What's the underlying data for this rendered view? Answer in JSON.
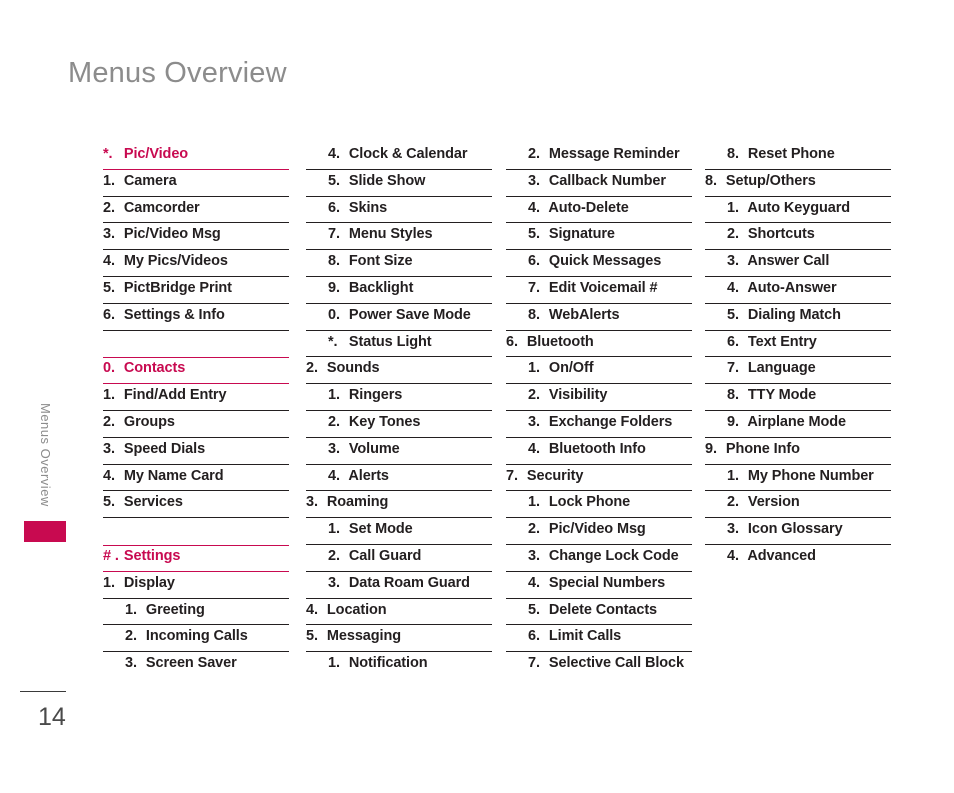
{
  "page": {
    "title": "Menus Overview",
    "side_text": "Menus Overview",
    "page_number": "14",
    "accent_color": "#c80a50",
    "title_color": "#8c8c8c",
    "text_color": "#231f20"
  },
  "columns": [
    {
      "rows": [
        {
          "num": "*.",
          "label": "Pic/Video",
          "level": 1,
          "type": "section",
          "top_rule": false
        },
        {
          "num": "1.",
          "label": "Camera",
          "level": 1,
          "type": "item"
        },
        {
          "num": "2.",
          "label": "Camcorder",
          "level": 1,
          "type": "item"
        },
        {
          "num": "3.",
          "label": "Pic/Video Msg",
          "level": 1,
          "type": "item"
        },
        {
          "num": "4.",
          "label": "My Pics/Videos",
          "level": 1,
          "type": "item"
        },
        {
          "num": "5.",
          "label": "PictBridge Print",
          "level": 1,
          "type": "item"
        },
        {
          "num": "6.",
          "label": "Settings & Info",
          "level": 1,
          "type": "item"
        },
        {
          "type": "spacer"
        },
        {
          "num": "0.",
          "label": "Contacts",
          "level": 1,
          "type": "section",
          "top_rule": true
        },
        {
          "num": "1.",
          "label": "Find/Add Entry",
          "level": 1,
          "type": "item"
        },
        {
          "num": "2.",
          "label": "Groups",
          "level": 1,
          "type": "item"
        },
        {
          "num": "3.",
          "label": "Speed Dials",
          "level": 1,
          "type": "item"
        },
        {
          "num": "4.",
          "label": "My Name Card",
          "level": 1,
          "type": "item"
        },
        {
          "num": "5.",
          "label": "Services",
          "level": 1,
          "type": "item"
        },
        {
          "type": "spacer"
        },
        {
          "num": "# .",
          "label": "Settings",
          "level": 1,
          "type": "section",
          "top_rule": true
        },
        {
          "num": "1.",
          "label": "Display",
          "level": 1,
          "type": "item"
        },
        {
          "num": "1.",
          "label": "Greeting",
          "level": 2,
          "type": "item"
        },
        {
          "num": "2.",
          "label": "Incoming Calls",
          "level": 2,
          "type": "item"
        },
        {
          "num": "3.",
          "label": "Screen Saver",
          "level": 2,
          "type": "item",
          "rule": false
        }
      ]
    },
    {
      "rows": [
        {
          "num": "4.",
          "label": "Clock & Calendar",
          "level": 2,
          "type": "item"
        },
        {
          "num": "5.",
          "label": "Slide Show",
          "level": 2,
          "type": "item"
        },
        {
          "num": "6.",
          "label": "Skins",
          "level": 2,
          "type": "item"
        },
        {
          "num": "7.",
          "label": "Menu Styles",
          "level": 2,
          "type": "item"
        },
        {
          "num": "8.",
          "label": "Font Size",
          "level": 2,
          "type": "item"
        },
        {
          "num": "9.",
          "label": "Backlight",
          "level": 2,
          "type": "item"
        },
        {
          "num": "0.",
          "label": "Power Save Mode",
          "level": 2,
          "type": "item"
        },
        {
          "num": "*.",
          "label": "Status Light",
          "level": 2,
          "type": "item"
        },
        {
          "num": "2.",
          "label": "Sounds",
          "level": 1,
          "type": "item"
        },
        {
          "num": "1.",
          "label": "Ringers",
          "level": 2,
          "type": "item"
        },
        {
          "num": "2.",
          "label": "Key Tones",
          "level": 2,
          "type": "item"
        },
        {
          "num": "3.",
          "label": "Volume",
          "level": 2,
          "type": "item"
        },
        {
          "num": "4.",
          "label": "Alerts",
          "level": 2,
          "type": "item"
        },
        {
          "num": "3.",
          "label": "Roaming",
          "level": 1,
          "type": "item"
        },
        {
          "num": "1.",
          "label": "Set Mode",
          "level": 2,
          "type": "item"
        },
        {
          "num": "2.",
          "label": "Call Guard",
          "level": 2,
          "type": "item"
        },
        {
          "num": "3.",
          "label": "Data Roam Guard",
          "level": 2,
          "type": "item"
        },
        {
          "num": "4.",
          "label": "Location",
          "level": 1,
          "type": "item"
        },
        {
          "num": "5.",
          "label": "Messaging",
          "level": 1,
          "type": "item"
        },
        {
          "num": "1.",
          "label": "Notification",
          "level": 2,
          "type": "item",
          "rule": false
        }
      ]
    },
    {
      "rows": [
        {
          "num": "2.",
          "label": "Message Reminder",
          "level": 2,
          "type": "item"
        },
        {
          "num": "3.",
          "label": "Callback Number",
          "level": 2,
          "type": "item"
        },
        {
          "num": "4.",
          "label": "Auto-Delete",
          "level": 2,
          "type": "item"
        },
        {
          "num": "5.",
          "label": "Signature",
          "level": 2,
          "type": "item"
        },
        {
          "num": "6.",
          "label": "Quick Messages",
          "level": 2,
          "type": "item"
        },
        {
          "num": "7.",
          "label": "Edit Voicemail #",
          "level": 2,
          "type": "item"
        },
        {
          "num": "8.",
          "label": "WebAlerts",
          "level": 2,
          "type": "item"
        },
        {
          "num": "6.",
          "label": "Bluetooth",
          "level": 1,
          "type": "item"
        },
        {
          "num": "1.",
          "label": "On/Off",
          "level": 2,
          "type": "item"
        },
        {
          "num": "2.",
          "label": "Visibility",
          "level": 2,
          "type": "item"
        },
        {
          "num": "3.",
          "label": "Exchange Folders",
          "level": 2,
          "type": "item"
        },
        {
          "num": "4.",
          "label": "Bluetooth Info",
          "level": 2,
          "type": "item"
        },
        {
          "num": "7.",
          "label": "Security",
          "level": 1,
          "type": "item"
        },
        {
          "num": "1.",
          "label": "Lock Phone",
          "level": 2,
          "type": "item"
        },
        {
          "num": "2.",
          "label": "Pic/Video Msg",
          "level": 2,
          "type": "item"
        },
        {
          "num": "3.",
          "label": "Change Lock Code",
          "level": 2,
          "type": "item"
        },
        {
          "num": "4.",
          "label": "Special Numbers",
          "level": 2,
          "type": "item"
        },
        {
          "num": "5.",
          "label": "Delete Contacts",
          "level": 2,
          "type": "item"
        },
        {
          "num": "6.",
          "label": "Limit Calls",
          "level": 2,
          "type": "item"
        },
        {
          "num": "7.",
          "label": "Selective Call Block",
          "level": 2,
          "type": "item",
          "rule": false
        }
      ]
    },
    {
      "rows": [
        {
          "num": "8.",
          "label": "Reset Phone",
          "level": 2,
          "type": "item"
        },
        {
          "num": "8.",
          "label": "Setup/Others",
          "level": 1,
          "type": "item"
        },
        {
          "num": "1.",
          "label": "Auto Keyguard",
          "level": 2,
          "type": "item"
        },
        {
          "num": "2.",
          "label": "Shortcuts",
          "level": 2,
          "type": "item"
        },
        {
          "num": "3.",
          "label": "Answer Call",
          "level": 2,
          "type": "item"
        },
        {
          "num": "4.",
          "label": "Auto-Answer",
          "level": 2,
          "type": "item"
        },
        {
          "num": "5.",
          "label": "Dialing Match",
          "level": 2,
          "type": "item"
        },
        {
          "num": "6.",
          "label": "Text Entry",
          "level": 2,
          "type": "item"
        },
        {
          "num": "7.",
          "label": "Language",
          "level": 2,
          "type": "item"
        },
        {
          "num": "8.",
          "label": "TTY Mode",
          "level": 2,
          "type": "item"
        },
        {
          "num": "9.",
          "label": "Airplane Mode",
          "level": 2,
          "type": "item"
        },
        {
          "num": "9.",
          "label": "Phone Info",
          "level": 1,
          "type": "item"
        },
        {
          "num": "1.",
          "label": "My Phone Number",
          "level": 2,
          "type": "item"
        },
        {
          "num": "2.",
          "label": "Version",
          "level": 2,
          "type": "item"
        },
        {
          "num": "3.",
          "label": "Icon Glossary",
          "level": 2,
          "type": "item"
        },
        {
          "num": "4.",
          "label": "Advanced",
          "level": 2,
          "type": "item",
          "rule": false
        }
      ]
    }
  ]
}
